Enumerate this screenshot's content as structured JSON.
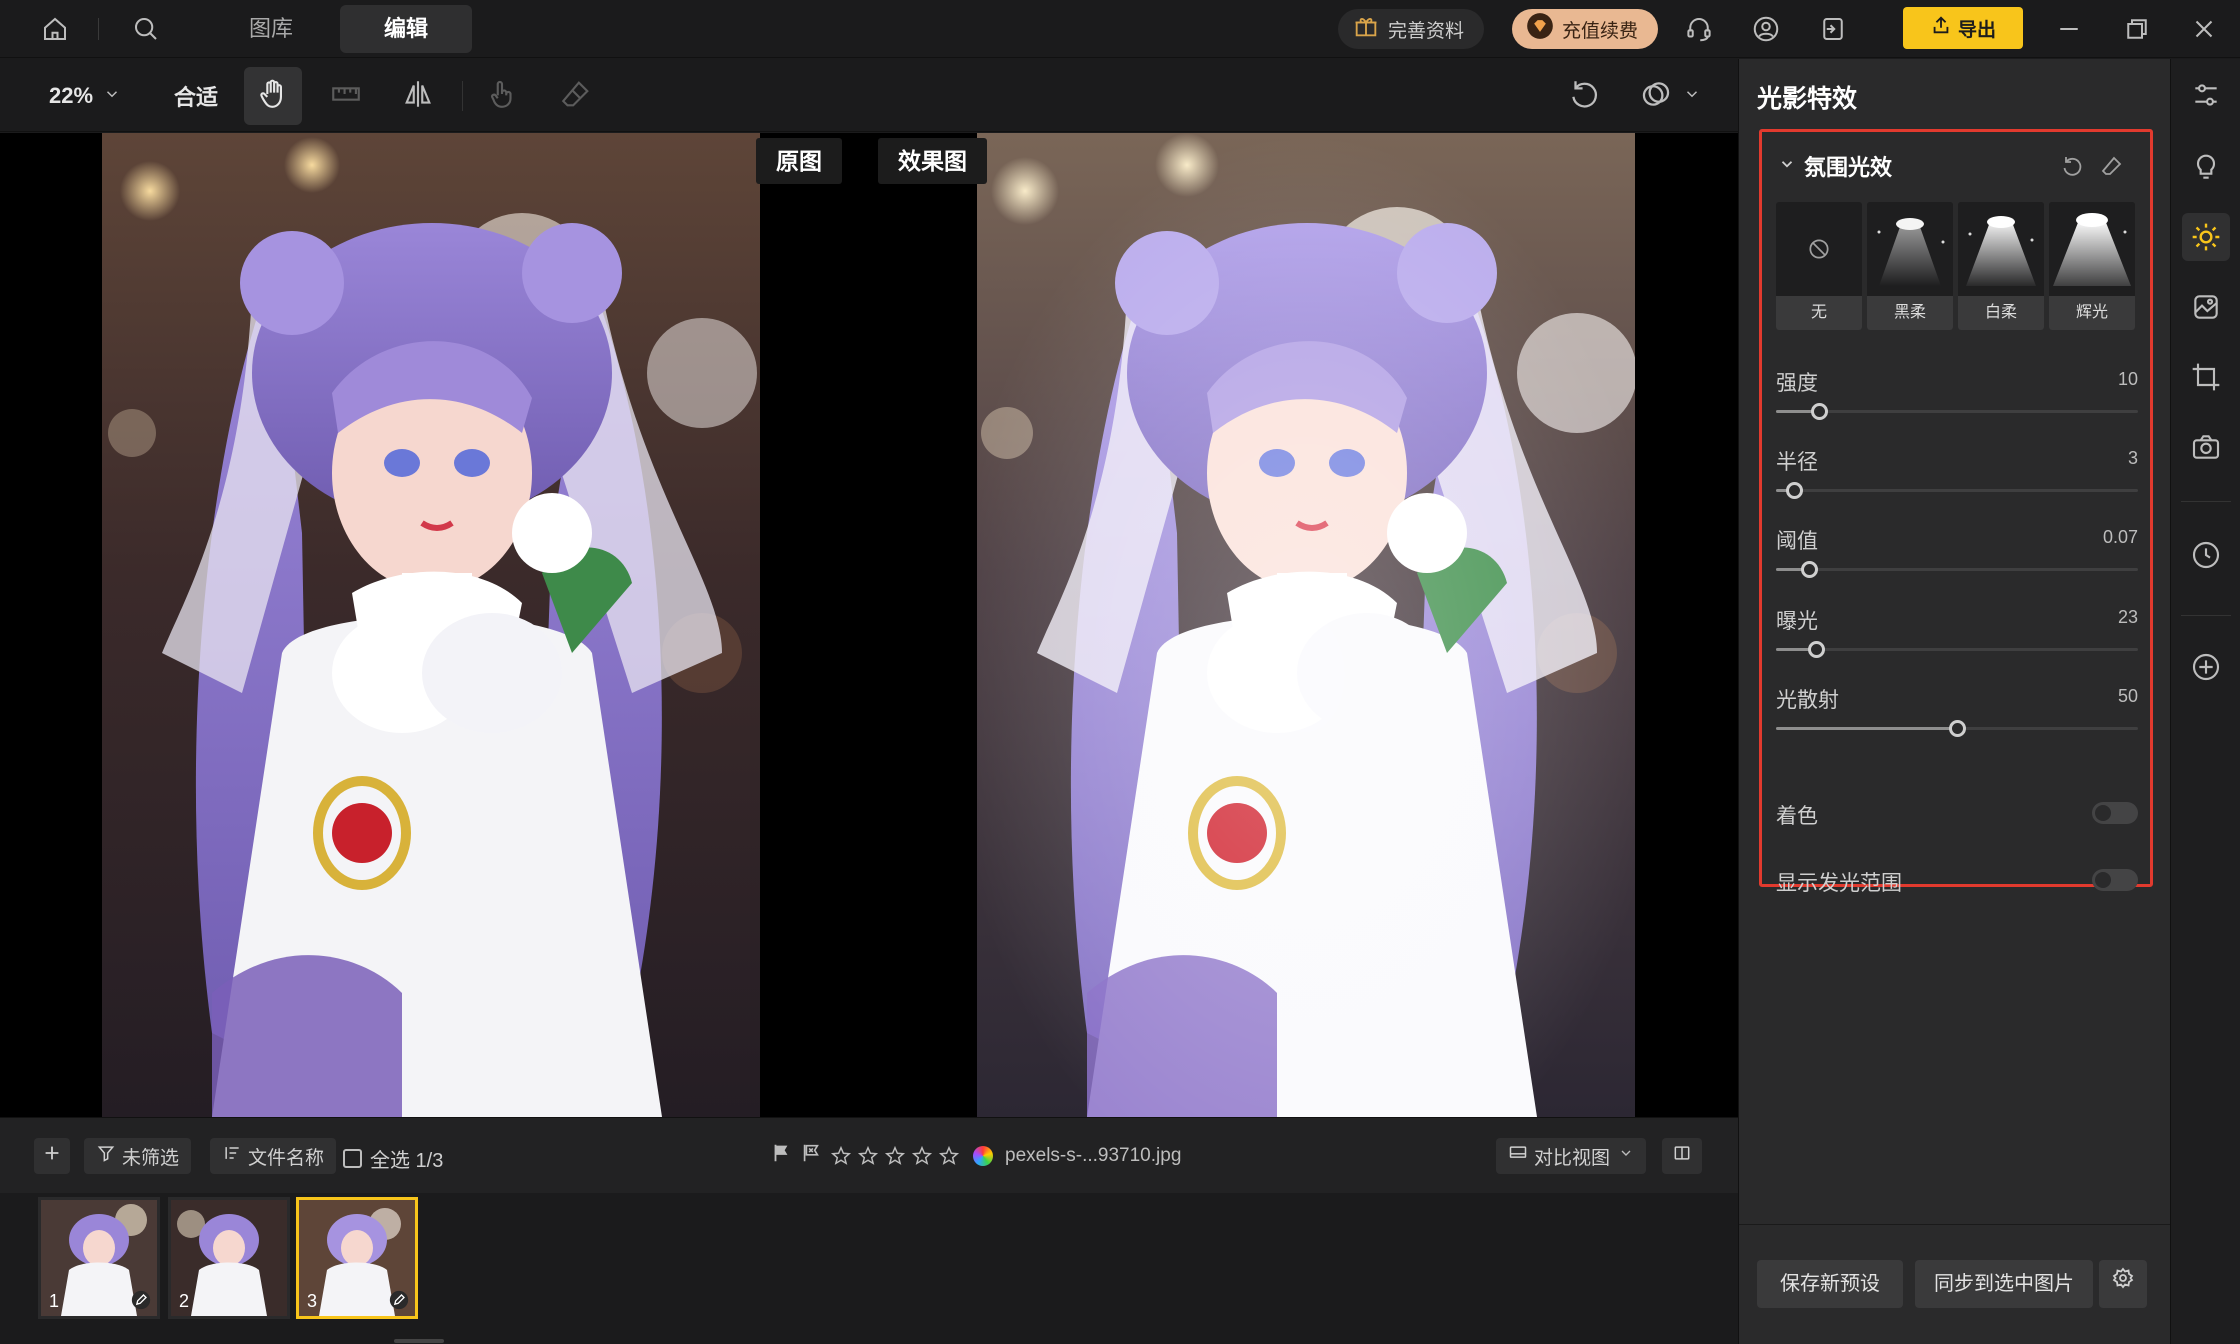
{
  "topbar": {
    "tabs": [
      {
        "label": "图库",
        "active": false
      },
      {
        "label": "编辑",
        "active": true
      }
    ],
    "profile_label": "完善资料",
    "recharge_label": "充值续费",
    "export_label": "导出"
  },
  "toolbar": {
    "zoom": "22%",
    "fit_label": "合适"
  },
  "canvas": {
    "original_label": "原图",
    "result_label": "效果图"
  },
  "filmstrip": {
    "filter_label": "未筛选",
    "sort_label": "文件名称",
    "select_all_label": "全选 1/3",
    "filename": "pexels-s-...93710.jpg",
    "view_mode_label": "对比视图",
    "rating_stars": 5,
    "thumbnails": [
      {
        "num": "1",
        "selected": false
      },
      {
        "num": "2",
        "selected": false
      },
      {
        "num": "3",
        "selected": true
      }
    ]
  },
  "panel": {
    "title": "光影特效",
    "section_title": "氛围光效",
    "presets": [
      {
        "label": "无"
      },
      {
        "label": "黑柔"
      },
      {
        "label": "白柔"
      },
      {
        "label": "辉光"
      }
    ],
    "sliders": [
      {
        "label": "强度",
        "value": "10",
        "fraction": 0.12
      },
      {
        "label": "半径",
        "value": "3",
        "fraction": 0.05
      },
      {
        "label": "阈值",
        "value": "0.07",
        "fraction": 0.09
      },
      {
        "label": "曝光",
        "value": "23",
        "fraction": 0.11
      },
      {
        "label": "光散射",
        "value": "50",
        "fraction": 0.5
      }
    ],
    "toggles": [
      {
        "label": "着色",
        "on": false
      },
      {
        "label": "显示发光范围",
        "on": false
      }
    ],
    "save_preset_label": "保存新预设",
    "sync_label": "同步到选中图片"
  },
  "colors": {
    "accent": "#f8c51b",
    "highlight_border": "#e23a2e",
    "background": "#1b1b1c",
    "panel": "#2a2a2b"
  }
}
